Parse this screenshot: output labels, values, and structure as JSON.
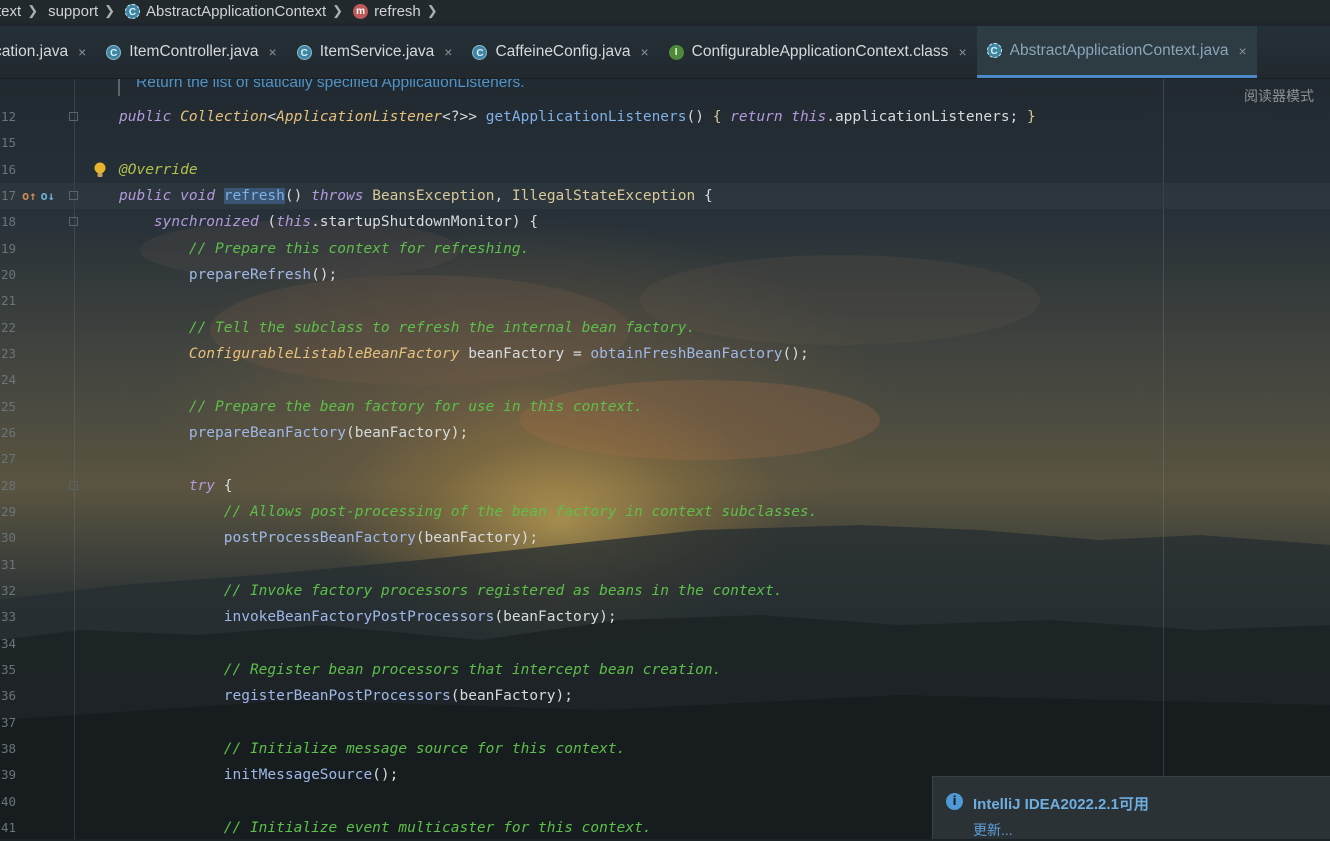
{
  "breadcrumb": {
    "items": [
      {
        "label": "text",
        "icon": ""
      },
      {
        "label": "support",
        "icon": ""
      },
      {
        "label": "AbstractApplicationContext",
        "icon": "abstract-class-icon"
      },
      {
        "label": "refresh",
        "icon": "method-icon"
      }
    ]
  },
  "tabs": [
    {
      "label": "cation.java",
      "icon": "",
      "active": false
    },
    {
      "label": "ItemController.java",
      "icon": "class-icon",
      "active": false
    },
    {
      "label": "ItemService.java",
      "icon": "class-icon",
      "active": false
    },
    {
      "label": "CaffeineConfig.java",
      "icon": "class-icon",
      "active": false
    },
    {
      "label": "ConfigurableApplicationContext.class",
      "icon": "interface-icon",
      "active": false
    },
    {
      "label": "AbstractApplicationContext.java",
      "icon": "abstract-class-icon",
      "active": true
    }
  ],
  "tab_close_glyph": "×",
  "reader_mode_label": "阅读器模式",
  "doc_comment": "Return the list of statically specified ApplicationListeners.",
  "code_lines": [
    {
      "n": "12",
      "html": "<span class=\"kw2\">public</span> <span class=\"typ\">Collection</span><span class=\"pl\">&lt;</span><span class=\"typ\">ApplicationListener</span><span class=\"pl\">&lt;?&gt;&gt;</span> <span class=\"fn\">getApplicationListeners</span><span class=\"pl\">() </span><span class=\"typ2\">{</span> <span class=\"kw2\">return</span> <span class=\"kw2\">this</span><span class=\"pl\">.applicationListeners; </span><span class=\"typ2\">}</span>",
      "fold": true
    },
    {
      "n": "15",
      "html": ""
    },
    {
      "n": "16",
      "html": "<span class=\"ann\">@Override</span>",
      "bulb": true
    },
    {
      "n": "17",
      "html": "<span class=\"kw2\">public</span> <span class=\"kw2\">void</span> <span class=\"fn hl\">refresh</span><span class=\"pl\">() </span><span class=\"kw2\">throws</span> <span class=\"typ2\">BeansException</span><span class=\"pl\">, </span><span class=\"typ2\">IllegalStateException</span> <span class=\"pl\">{</span>",
      "icons": true,
      "fold": true
    },
    {
      "n": "18",
      "html": "    <span class=\"kw2\">synchronized</span> <span class=\"pl\">(</span><span class=\"kw2\">this</span><span class=\"pl\">.startupShutdownMonitor) {</span>",
      "fold": true
    },
    {
      "n": "19",
      "html": "        <span class=\"cmt\">// Prepare this context for refreshing.</span>"
    },
    {
      "n": "20",
      "html": "        <span class=\"fn2\">prepareRefresh</span><span class=\"pl\">();</span>"
    },
    {
      "n": "21",
      "html": ""
    },
    {
      "n": "22",
      "html": "        <span class=\"cmt\">// Tell the subclass to refresh the internal bean factory.</span>"
    },
    {
      "n": "23",
      "html": "        <span class=\"typ\">ConfigurableListableBeanFactory</span> <span class=\"pl\">beanFactory = </span><span class=\"fn2\">obtainFreshBeanFactory</span><span class=\"pl\">();</span>"
    },
    {
      "n": "24",
      "html": ""
    },
    {
      "n": "25",
      "html": "        <span class=\"cmt\">// Prepare the bean factory for use in this context.</span>"
    },
    {
      "n": "26",
      "html": "        <span class=\"fn2\">prepareBeanFactory</span><span class=\"pl\">(beanFactory);</span>"
    },
    {
      "n": "27",
      "html": ""
    },
    {
      "n": "28",
      "html": "        <span class=\"kw2\">try</span> <span class=\"pl\">{</span>",
      "fold": true
    },
    {
      "n": "29",
      "html": "            <span class=\"cmt\">// Allows post-processing of the bean factory in context subclasses.</span>"
    },
    {
      "n": "30",
      "html": "            <span class=\"fn2\">postProcessBeanFactory</span><span class=\"pl\">(beanFactory);</span>"
    },
    {
      "n": "31",
      "html": ""
    },
    {
      "n": "32",
      "html": "            <span class=\"cmt\">// Invoke factory processors registered as beans in the context.</span>"
    },
    {
      "n": "33",
      "html": "            <span class=\"fn2\">invokeBeanFactoryPostProcessors</span><span class=\"pl\">(beanFactory);</span>"
    },
    {
      "n": "34",
      "html": ""
    },
    {
      "n": "35",
      "html": "            <span class=\"cmt\">// Register bean processors that intercept bean creation.</span>"
    },
    {
      "n": "36",
      "html": "            <span class=\"fn2\">registerBeanPostProcessors</span><span class=\"pl\">(beanFactory);</span>"
    },
    {
      "n": "37",
      "html": ""
    },
    {
      "n": "38",
      "html": "            <span class=\"cmt\">// Initialize message source for this context.</span>"
    },
    {
      "n": "39",
      "html": "            <span class=\"fn2\">initMessageSource</span><span class=\"pl\">();</span>"
    },
    {
      "n": "40",
      "html": ""
    },
    {
      "n": "41",
      "html": "            <span class=\"cmt\">// Initialize event multicaster for this context.</span>"
    }
  ],
  "notification": {
    "icon": "info-icon",
    "glyph": "i",
    "title": "IntelliJ IDEA2022.2.1可用",
    "link": "更新..."
  },
  "colors": {
    "comment": "#5dbf4a",
    "keyword": "#b39adc",
    "type": "#e5c07b",
    "method": "#7fb0e8",
    "active_tab_underline": "#4a88c7",
    "notification_title": "#6faee0"
  }
}
